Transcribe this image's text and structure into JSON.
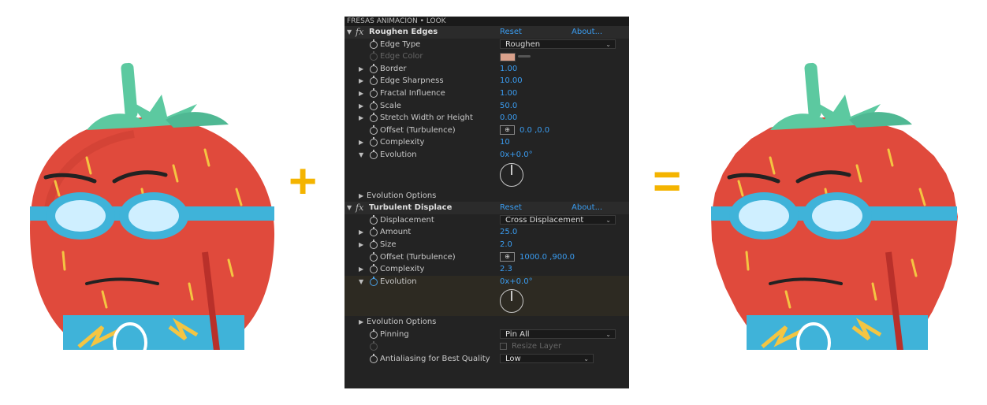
{
  "operators": {
    "plus": "+",
    "equals": "="
  },
  "panel": {
    "title": "FRESAS ANIMACION • LOOK",
    "effects": [
      {
        "name": "Roughen Edges",
        "reset": "Reset",
        "about": "About...",
        "params": {
          "edge_type": {
            "label": "Edge Type",
            "value": "Roughen"
          },
          "edge_color": {
            "label": "Edge Color",
            "color": "#d9a08a"
          },
          "border": {
            "label": "Border",
            "value": "1.00"
          },
          "edge_sharpness": {
            "label": "Edge Sharpness",
            "value": "10.00"
          },
          "fractal_influence": {
            "label": "Fractal Influence",
            "value": "1.00"
          },
          "scale": {
            "label": "Scale",
            "value": "50.0"
          },
          "stretch": {
            "label": "Stretch Width or Height",
            "value": "0.00"
          },
          "offset": {
            "label": "Offset (Turbulence)",
            "value": "0.0 ,0.0"
          },
          "complexity": {
            "label": "Complexity",
            "value": "10"
          },
          "evolution": {
            "label": "Evolution",
            "value": "0x+0.0°"
          },
          "evolution_options": {
            "label": "Evolution Options"
          }
        }
      },
      {
        "name": "Turbulent Displace",
        "reset": "Reset",
        "about": "About...",
        "params": {
          "displacement": {
            "label": "Displacement",
            "value": "Cross Displacement"
          },
          "amount": {
            "label": "Amount",
            "value": "25.0"
          },
          "size": {
            "label": "Size",
            "value": "2.0"
          },
          "offset": {
            "label": "Offset (Turbulence)",
            "value": "1000.0 ,900.0"
          },
          "complexity": {
            "label": "Complexity",
            "value": "2.3"
          },
          "evolution": {
            "label": "Evolution",
            "value": "0x+0.0°"
          },
          "evolution_options": {
            "label": "Evolution Options"
          },
          "pinning": {
            "label": "Pinning",
            "value": "Pin All"
          },
          "resize_layer": {
            "label": "Resize Layer"
          },
          "antialiasing": {
            "label": "Antialiasing for Best Quality",
            "value": "Low"
          }
        }
      }
    ]
  },
  "colors": {
    "accent_orange": "#f4b400",
    "link_blue": "#3a9cf0",
    "panel_bg": "#232323",
    "strawberry_red": "#e04a3c",
    "leaf_green": "#5cc9a0",
    "goggle_blue": "#3fb3d9"
  }
}
